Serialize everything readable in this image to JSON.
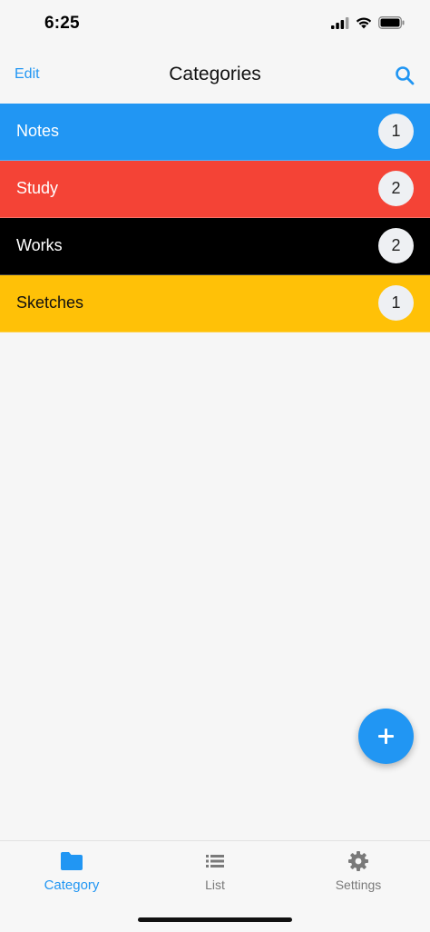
{
  "status_bar": {
    "time": "6:25",
    "icons": [
      "cellular-signal-icon",
      "wifi-icon",
      "battery-icon"
    ]
  },
  "nav": {
    "edit_label": "Edit",
    "title": "Categories",
    "search_icon": "search-icon"
  },
  "categories": [
    {
      "name": "Notes",
      "count": "1",
      "color": "#2196f3",
      "text_color": "#ffffff"
    },
    {
      "name": "Study",
      "count": "2",
      "color": "#f44336",
      "text_color": "#ffffff"
    },
    {
      "name": "Works",
      "count": "2",
      "color": "#000000",
      "text_color": "#ffffff"
    },
    {
      "name": "Sketches",
      "count": "1",
      "color": "#ffc107",
      "text_color": "#111111"
    }
  ],
  "fab": {
    "icon": "plus-icon",
    "color": "#2196f3"
  },
  "tabs": [
    {
      "label": "Category",
      "icon": "folder-icon",
      "active": true
    },
    {
      "label": "List",
      "icon": "list-icon",
      "active": false
    },
    {
      "label": "Settings",
      "icon": "gear-icon",
      "active": false
    }
  ],
  "colors": {
    "accent": "#2196f3",
    "background": "#f6f6f6"
  }
}
